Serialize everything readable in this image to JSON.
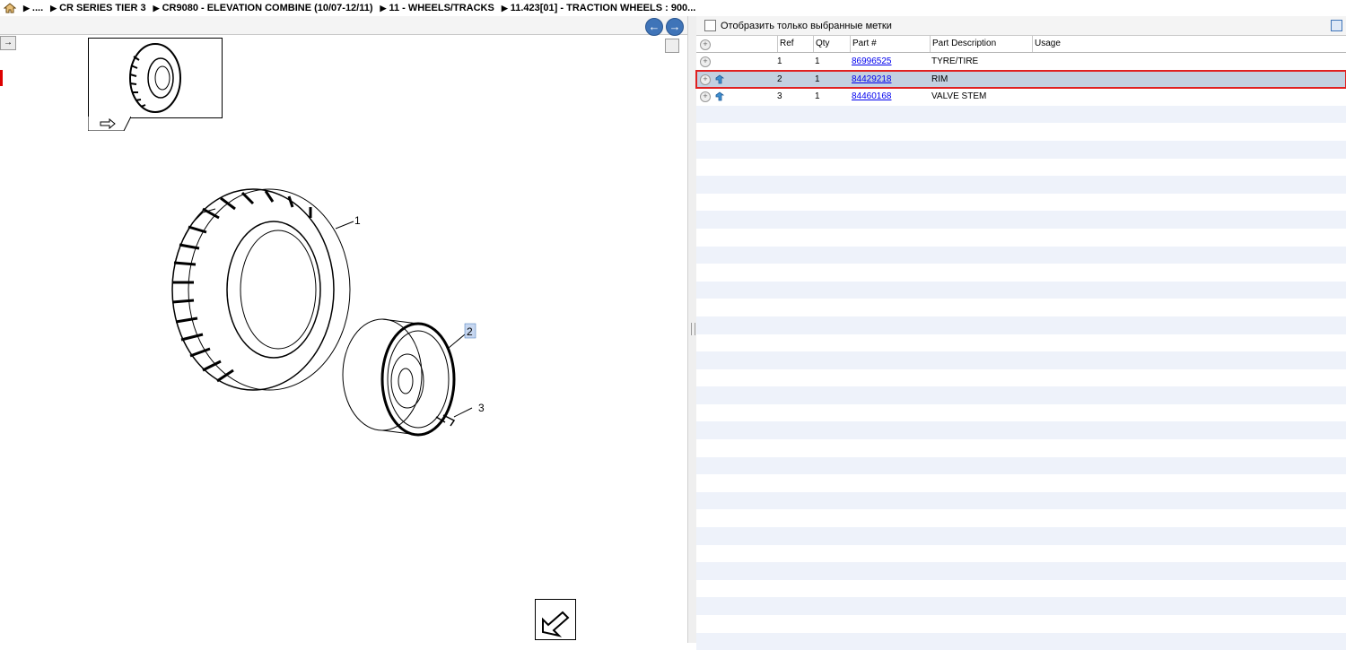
{
  "breadcrumb": {
    "items": [
      {
        "label": "...."
      },
      {
        "label": "CR SERIES TIER 3"
      },
      {
        "label": "CR9080 - ELEVATION COMBINE (10/07-12/11)"
      },
      {
        "label": "11 - WHEELS/TRACKS"
      },
      {
        "label": "11.423[01] - TRACTION WHEELS : 900..."
      }
    ]
  },
  "diagram": {
    "callouts": [
      "1",
      "2",
      "3"
    ]
  },
  "filter": {
    "label": "Отобразить только выбранные метки"
  },
  "table": {
    "headers": {
      "ref": "Ref",
      "qty": "Qty",
      "part": "Part #",
      "desc": "Part Description",
      "usage": "Usage"
    },
    "rows": [
      {
        "ref": "1",
        "qty": "1",
        "part": "86996525",
        "desc": "TYRE/TIRE",
        "usage": ""
      },
      {
        "ref": "2",
        "qty": "1",
        "part": "84429218",
        "desc": "RIM",
        "usage": ""
      },
      {
        "ref": "3",
        "qty": "1",
        "part": "84460168",
        "desc": "VALVE STEM",
        "usage": ""
      }
    ],
    "selected_row": 2
  },
  "colors": {
    "accent": "#3f74b8",
    "selection_outline": "#e02020",
    "selection_fill": "#c3d0e0",
    "row_alt": "#eef2fa",
    "link": "#0000ee"
  },
  "icons": [
    "home-icon",
    "back-arrow-icon",
    "forward-arrow-icon",
    "expand-icon",
    "hook-icon",
    "grid-settings-icon",
    "zoom-out-icon"
  ]
}
